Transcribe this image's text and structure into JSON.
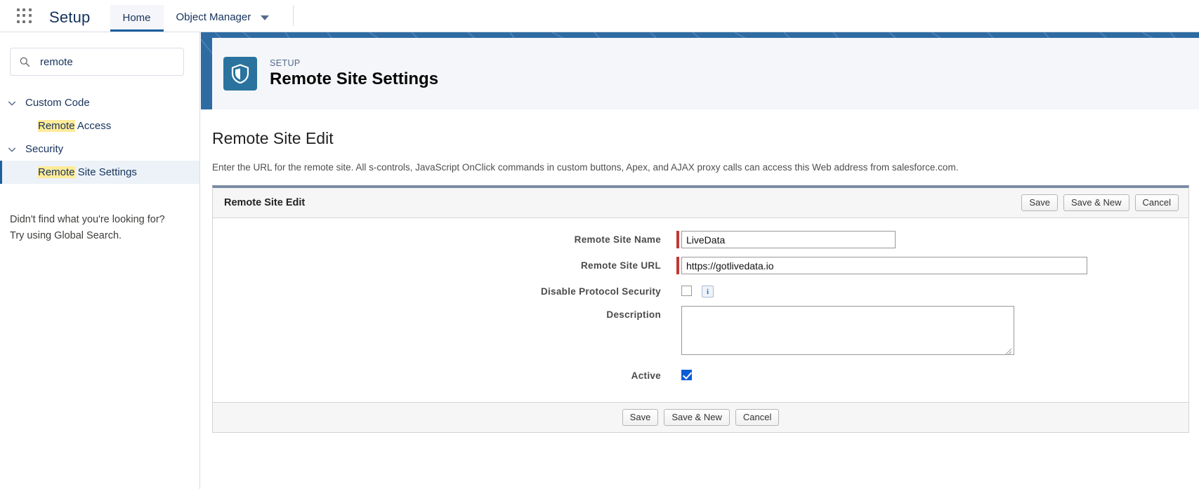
{
  "global_header": {
    "app_launcher_icon": "app-launcher-grid-icon",
    "setup_title": "Setup",
    "tabs": [
      {
        "label": "Home",
        "active": true
      },
      {
        "label": "Object Manager",
        "active": false,
        "caret": "chevron-down-icon"
      }
    ]
  },
  "sidebar": {
    "search": {
      "icon": "search-icon",
      "value": "remote",
      "placeholder": "Quick Find"
    },
    "tree": [
      {
        "type": "group",
        "label": "Custom Code",
        "icon": "chevron-down-icon",
        "children": [
          {
            "label_match": "Remote",
            "label_rest": " Access",
            "selected": false
          }
        ]
      },
      {
        "type": "group",
        "label": "Security",
        "icon": "chevron-down-icon",
        "children": [
          {
            "label_match": "Remote",
            "label_rest": " Site Settings",
            "selected": true
          }
        ]
      }
    ],
    "note_line1": "Didn't find what you're looking for?",
    "note_line2": "Try using Global Search."
  },
  "banner": {
    "icon": "shield-icon",
    "eyebrow": "SETUP",
    "title": "Remote Site Settings",
    "bg_color": "#2f6ba3",
    "badge_color": "#2a739e"
  },
  "page": {
    "title": "Remote Site Edit",
    "description": "Enter the URL for the remote site. All s-controls, JavaScript OnClick commands in custom buttons, Apex, and AJAX proxy calls can access this Web address from salesforce.com."
  },
  "form": {
    "section_title": "Remote Site Edit",
    "top_buttons": [
      {
        "label": "Save",
        "name": "save-button"
      },
      {
        "label": "Save & New",
        "name": "save-and-new-button"
      },
      {
        "label": "Cancel",
        "name": "cancel-button"
      }
    ],
    "bottom_buttons": [
      {
        "label": "Save",
        "name": "save-button"
      },
      {
        "label": "Save & New",
        "name": "save-and-new-button"
      },
      {
        "label": "Cancel",
        "name": "cancel-button"
      }
    ],
    "fields": {
      "remote_site_name": {
        "label": "Remote Site Name",
        "value": "LiveData",
        "required": true,
        "placeholder": ""
      },
      "remote_site_url": {
        "label": "Remote Site URL",
        "value": "https://gotlivedata.io",
        "required": true,
        "placeholder": ""
      },
      "disable_protocol_security": {
        "label": "Disable Protocol Security",
        "checked": false,
        "info_icon": "info-icon",
        "info_label": "i"
      },
      "description": {
        "label": "Description",
        "value": "",
        "placeholder": ""
      },
      "active": {
        "label": "Active",
        "checked": true
      }
    },
    "required_color": "#c23934",
    "accent_color": "#1b5f9e"
  }
}
